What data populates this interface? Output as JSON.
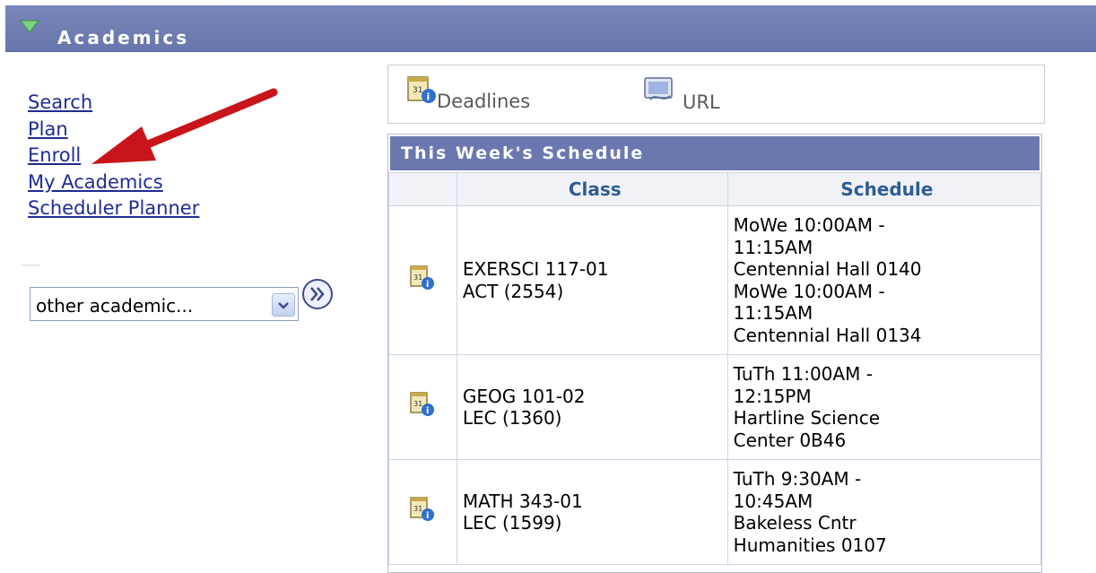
{
  "header": {
    "title": "Academics"
  },
  "links": [
    "Search",
    "Plan",
    "Enroll",
    "My Academics",
    "Scheduler Planner"
  ],
  "dropdown": {
    "selected": "other academic..."
  },
  "toolbar": {
    "deadlines_label": "Deadlines",
    "url_label": "URL"
  },
  "schedule": {
    "title": "This Week's Schedule",
    "columns": [
      "Class",
      "Schedule"
    ],
    "rows": [
      {
        "class_line1": "EXERSCI 117-01",
        "class_line2": "ACT (2554)",
        "schedule_lines": [
          "MoWe 10:00AM -",
          "11:15AM",
          "Centennial Hall 0140",
          "MoWe 10:00AM -",
          "11:15AM",
          "Centennial Hall 0134"
        ]
      },
      {
        "class_line1": "GEOG 101-02",
        "class_line2": "LEC (1360)",
        "schedule_lines": [
          "TuTh 11:00AM -",
          "12:15PM",
          "Hartline Science",
          "Center 0B46"
        ]
      },
      {
        "class_line1": "MATH 343-01",
        "class_line2": "LEC (1599)",
        "schedule_lines": [
          "TuTh 9:30AM -",
          "10:45AM",
          "Bakeless Cntr",
          "Humanities 0107"
        ]
      }
    ]
  },
  "colors": {
    "header_bar": "#6b78b0",
    "link": "#1f2c95",
    "column_header_text": "#2e5c92",
    "arrow": "#c8141a"
  }
}
